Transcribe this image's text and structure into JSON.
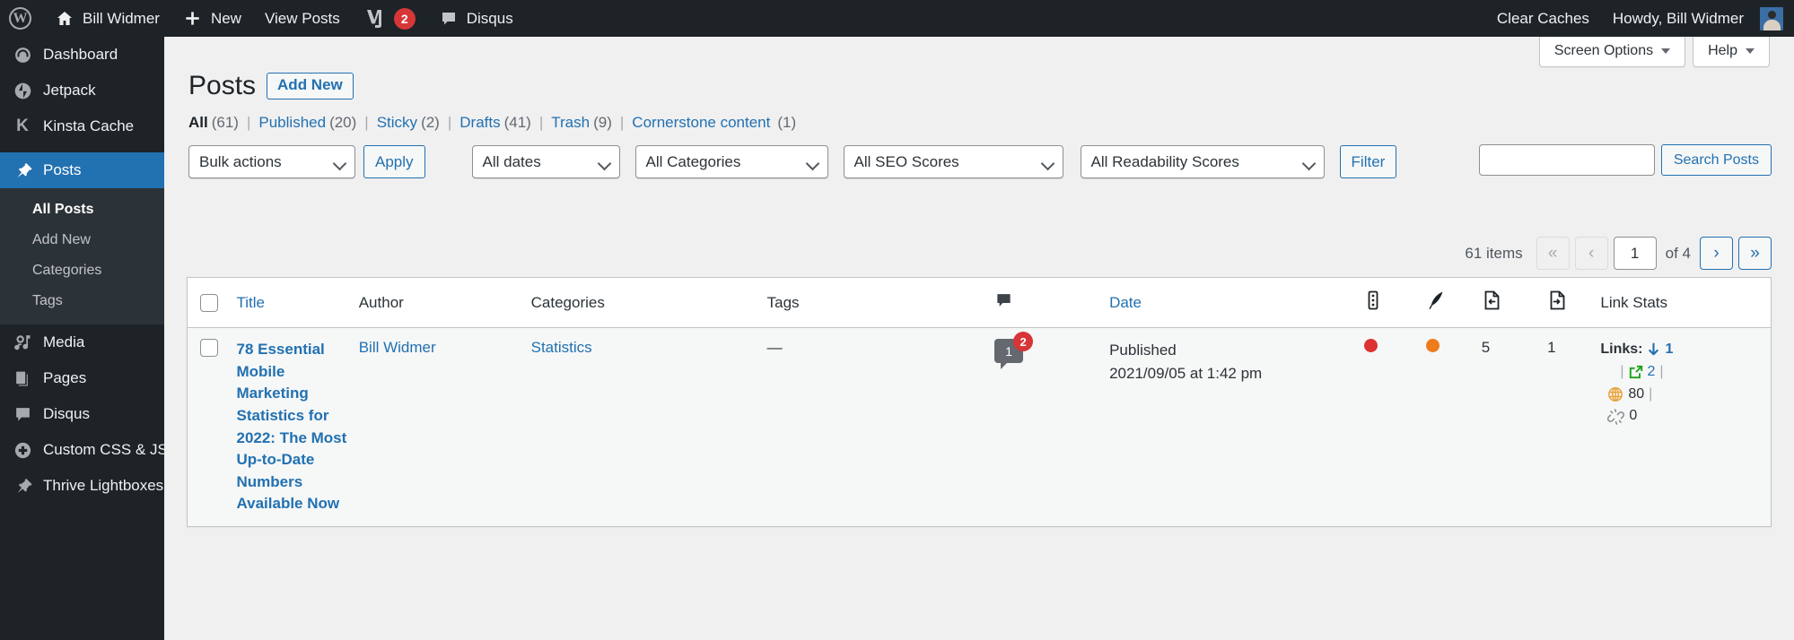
{
  "adminbar": {
    "wp_logo": "wordpress-logo",
    "site_name": "Bill Widmer",
    "new_label": "New",
    "view_posts": "View Posts",
    "yoast_label": "Yoast SEO",
    "yoast_count": "2",
    "disqus": "Disqus",
    "clear_caches": "Clear Caches",
    "howdy": "Howdy, Bill Widmer"
  },
  "sidebar": {
    "items": [
      {
        "label": "Dashboard",
        "icon": "dashboard-icon"
      },
      {
        "label": "Jetpack",
        "icon": "jetpack-icon"
      },
      {
        "label": "Kinsta Cache",
        "icon": "kinsta-icon"
      },
      {
        "label": "Posts",
        "icon": "pin-icon",
        "current": true
      },
      {
        "label": "Media",
        "icon": "media-icon"
      },
      {
        "label": "Pages",
        "icon": "pages-icon"
      },
      {
        "label": "Disqus",
        "icon": "comment-icon"
      },
      {
        "label": "Custom CSS & JS",
        "icon": "plus-circle-icon"
      },
      {
        "label": "Thrive Lightboxes",
        "icon": "pin-icon"
      }
    ],
    "submenu": [
      {
        "label": "All Posts",
        "current": true
      },
      {
        "label": "Add New"
      },
      {
        "label": "Categories"
      },
      {
        "label": "Tags"
      }
    ]
  },
  "screen_meta": {
    "screen_options": "Screen Options",
    "help": "Help"
  },
  "page": {
    "title": "Posts",
    "add_new": "Add New"
  },
  "status_links": [
    {
      "label": "All",
      "count": "(61)",
      "current": true
    },
    {
      "label": "Published",
      "count": "(20)"
    },
    {
      "label": "Sticky",
      "count": "(2)"
    },
    {
      "label": "Drafts",
      "count": "(41)"
    },
    {
      "label": "Trash",
      "count": "(9)"
    },
    {
      "label": "Cornerstone content",
      "count": "(1)"
    }
  ],
  "search": {
    "value": "",
    "placeholder": "",
    "button": "Search Posts"
  },
  "toolbar": {
    "bulk_actions": "Bulk actions",
    "apply": "Apply",
    "all_dates": "All dates",
    "all_categories": "All Categories",
    "all_seo_scores": "All SEO Scores",
    "all_readability_scores": "All Readability Scores",
    "filter": "Filter"
  },
  "pagination": {
    "items": "61 items",
    "first": "«",
    "prev": "‹",
    "current": "1",
    "of": "of 4",
    "next": "›",
    "last": "»"
  },
  "table": {
    "columns": {
      "title": "Title",
      "author": "Author",
      "categories": "Categories",
      "tags": "Tags",
      "comments": "comment-icon",
      "date": "Date",
      "seo": "seo-score-icon",
      "readability": "readability-feather-icon",
      "links_in": "inbound-links-icon",
      "links_out": "outbound-links-icon",
      "link_stats": "Link Stats"
    },
    "rows": [
      {
        "title": "78 Essential Mobile Marketing Statistics for 2022: The Most Up-to-Date Numbers Available Now",
        "author": "Bill Widmer",
        "categories": "Statistics",
        "tags": "—",
        "comment_count": "1",
        "comment_pending": "2",
        "date_status": "Published",
        "date_value": "2021/09/05 at 1:42 pm",
        "seo_color": "#dc3232",
        "readability_color": "#ee7c1b",
        "links_in": "5",
        "links_out": "1",
        "link_stats": {
          "label": "Links:",
          "inbound_icon": "arrow-down-icon",
          "inbound": "1",
          "outbound_icon": "external-link-icon",
          "outbound": "2",
          "global_icon": "globe-icon",
          "global": "80",
          "broken_icon": "broken-link-icon",
          "broken": "0"
        }
      }
    ]
  },
  "colors": {
    "admin_dark": "#1d2327",
    "accent_blue": "#2271b1",
    "red": "#d63638",
    "orange": "#ee7c1b",
    "green": "#1aa417"
  }
}
